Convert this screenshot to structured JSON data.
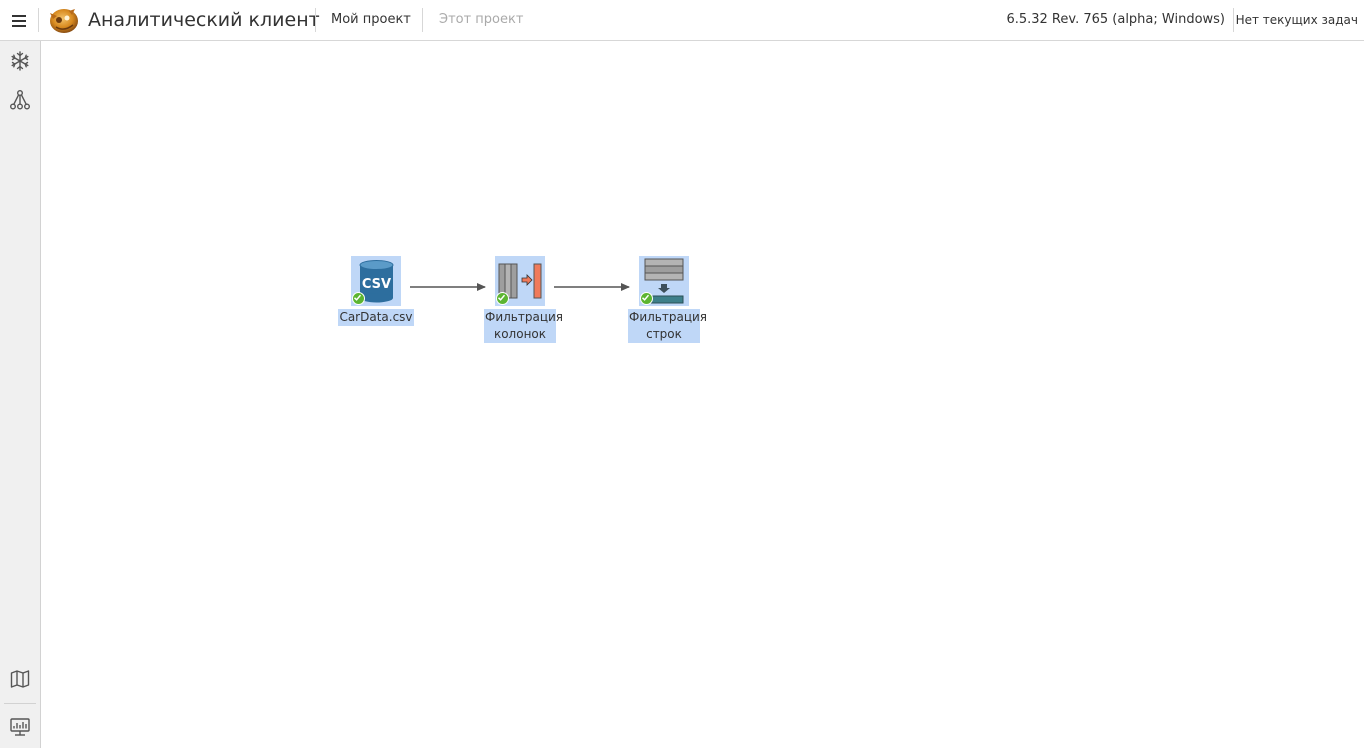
{
  "header": {
    "app_title": "Аналитический клиент",
    "nav": [
      {
        "label": "Мой проект",
        "state": "active"
      },
      {
        "label": "Этот проект",
        "state": "disabled"
      }
    ],
    "version": "6.5.32 Rev. 765 (alpha; Windows)",
    "tasks_label": "Нет текущих задач"
  },
  "sidebar": {
    "top_icons": [
      "snowflake-icon",
      "workflow-icon"
    ],
    "bottom_icons": [
      "map-icon",
      "monitor-icon"
    ]
  },
  "canvas": {
    "nodes": [
      {
        "id": "csv",
        "label": "CarData.csv",
        "icon": "csv-database-icon",
        "status": "success",
        "selected": true
      },
      {
        "id": "colfilter",
        "label": "Фильтрация колонок",
        "icon": "column-filter-icon",
        "status": "success",
        "selected": true
      },
      {
        "id": "rowfilter",
        "label": "Фильтрация строк",
        "icon": "row-filter-icon",
        "status": "success",
        "selected": true
      }
    ],
    "icon_text": {
      "csv": "CSV"
    },
    "edges": [
      {
        "from": "csv",
        "to": "colfilter"
      },
      {
        "from": "colfilter",
        "to": "rowfilter"
      }
    ]
  },
  "colors": {
    "selection": "#bfd7f7",
    "status_success": "#5cb531",
    "edge": "#555555",
    "sidebar_bg": "#f0f0f0",
    "disabled_text": "#aaaaaa"
  }
}
